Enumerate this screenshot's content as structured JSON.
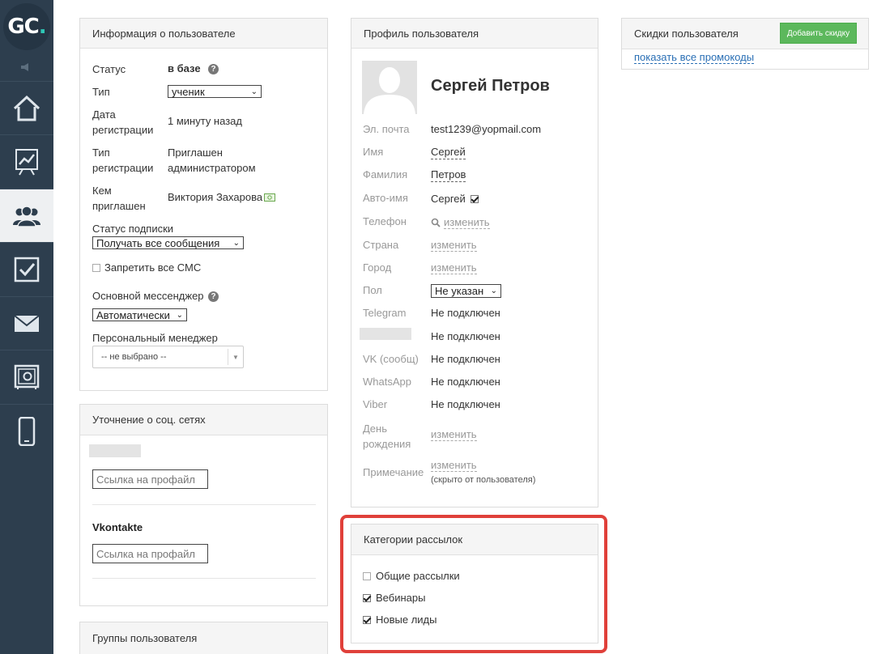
{
  "app": {
    "logo_text": "GC",
    "logo_dot": "."
  },
  "colors": {
    "sidebar": "#2d3e4e",
    "accent": "#2ec7b6",
    "highlight": "#e0403a",
    "button": "#5cb85c",
    "link": "#2a6fb5"
  },
  "sidebar": {
    "items": [
      {
        "icon": "home-icon"
      },
      {
        "icon": "chart-icon"
      },
      {
        "icon": "users-icon",
        "active": true
      },
      {
        "icon": "checkbox-icon"
      },
      {
        "icon": "mail-icon"
      },
      {
        "icon": "safe-icon"
      },
      {
        "icon": "phone-icon"
      }
    ]
  },
  "user_info": {
    "title": "Информация о пользователе",
    "status_label": "Статус",
    "status_value": "в базе",
    "type_label": "Тип",
    "type_value": "ученик",
    "reg_date_label_1": "Дата",
    "reg_date_label_2": "регистрации",
    "reg_date_value": "1 минуту назад",
    "reg_type_label_1": "Тип",
    "reg_type_label_2": "регистрации",
    "reg_type_value_1": "Приглашен",
    "reg_type_value_2": "администратором",
    "invited_label_1": "Кем",
    "invited_label_2": "приглашен",
    "invited_value": "Виктория Захарова",
    "subscription_label": "Статус подписки",
    "subscription_value": "Получать все сообщения",
    "ban_sms_label": "Запретить все СМС",
    "messenger_label": "Основной мессенджер",
    "messenger_value": "Автоматически",
    "manager_label": "Персональный менеджер",
    "manager_value": "-- не выбрано --"
  },
  "social": {
    "title": "Уточнение о соц. сетях",
    "profile_placeholder": "Ссылка на профайл",
    "vk_label": "Vkontakte"
  },
  "groups": {
    "title": "Группы пользователя"
  },
  "profile": {
    "title": "Профиль пользователя",
    "name": "Сергей Петров",
    "email_label": "Эл. почта",
    "email_value": "test1239@yopmail.com",
    "first_name_label": "Имя",
    "first_name_value": "Сергей",
    "last_name_label": "Фамилия",
    "last_name_value": "Петров",
    "auto_name_label": "Авто-имя",
    "auto_name_value": "Сергей",
    "phone_label": "Телефон",
    "change": "изменить",
    "country_label": "Страна",
    "city_label": "Город",
    "gender_label": "Пол",
    "gender_value": "Не указан",
    "telegram_label": "Telegram",
    "not_connected": "Не подключен",
    "vk_label": "VK (сообщ)",
    "whatsapp_label": "WhatsApp",
    "viber_label": "Viber",
    "birthday_label_1": "День",
    "birthday_label_2": "рождения",
    "note_label": "Примечание",
    "note_hint": "(скрыто от пользователя)"
  },
  "mailing": {
    "title": "Категории рассылок",
    "items": [
      {
        "label": "Общие рассылки",
        "checked": false
      },
      {
        "label": "Вебинары",
        "checked": true
      },
      {
        "label": "Новые лиды",
        "checked": true
      }
    ]
  },
  "discounts": {
    "title": "Скидки пользователя",
    "add_button": "Добавить скидку",
    "show_promos": "показать все промокоды"
  }
}
